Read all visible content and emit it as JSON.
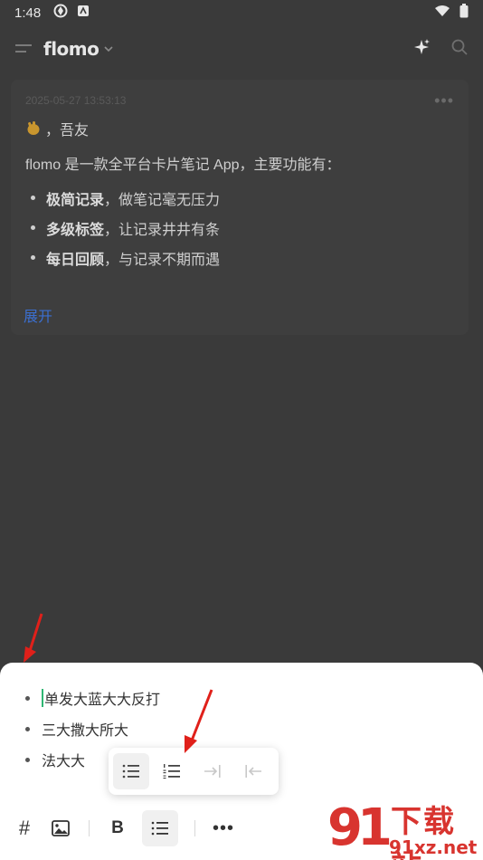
{
  "status_bar": {
    "time": "1:48"
  },
  "header": {
    "brand": "flomo"
  },
  "memo": {
    "date": "2025-05-27 13:53:13",
    "greeting": "，吾友",
    "intro": "flomo 是一款全平台卡片笔记 App，主要功能有：",
    "features": [
      {
        "bold": "极简记录",
        "rest": "，做笔记毫无压力"
      },
      {
        "bold": "多级标签",
        "rest": "，让记录井井有条"
      },
      {
        "bold": "每日回顾",
        "rest": "，与记录不期而遇"
      }
    ],
    "expand_label": "展开"
  },
  "editor": {
    "lines": [
      "单发大蓝大大反打",
      "三大撒大所大",
      "法大大"
    ]
  },
  "toolbar": {
    "hash": "#",
    "bold": "B",
    "more": "•••"
  },
  "watermark": {
    "brand_text": "下载站",
    "domain": "91xz.net",
    "logo": "91"
  },
  "colors": {
    "accent_link": "#3b6fd0",
    "caret": "#2fb673",
    "annotation": "#e0201a"
  }
}
